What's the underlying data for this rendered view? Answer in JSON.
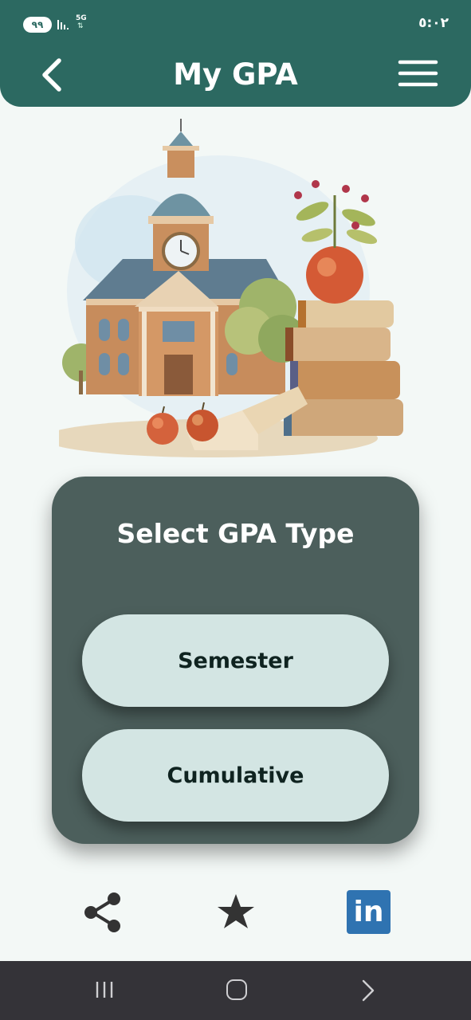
{
  "status_bar": {
    "battery": "٩٩",
    "network": "5G",
    "data_arrows": "⇅",
    "time": "٥:٠٢"
  },
  "app_bar": {
    "title": "My GPA",
    "back_icon": "chevron-left-icon",
    "menu_icon": "hamburger-menu-icon"
  },
  "card": {
    "title": "Select GPA Type",
    "buttons": [
      {
        "label": "Semester"
      },
      {
        "label": "Cumulative"
      }
    ]
  },
  "bottom_actions": {
    "share_icon": "share-icon",
    "star_icon": "star-icon",
    "linkedin_label": "in"
  },
  "nav_bar": {
    "recent_icon": "recent-apps-icon",
    "home_icon": "home-icon",
    "back_icon": "nav-back-icon"
  },
  "colors": {
    "header": "#2c6961",
    "card": "#4c5f5c",
    "button": "#d3e5e3",
    "background": "#f3f8f6",
    "linkedin": "#2f73b1",
    "nav_bar": "#343338"
  }
}
